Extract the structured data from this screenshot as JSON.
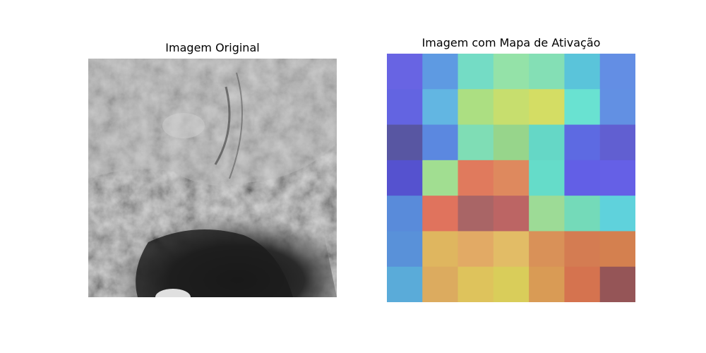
{
  "panels": {
    "left": {
      "title": "Imagem Original"
    },
    "right": {
      "title": "Imagem com Mapa de Ativação"
    }
  },
  "heatmap": {
    "rows": 7,
    "cols": 7,
    "colors": [
      [
        "#6864e3",
        "#5e9ae2",
        "#74dcc5",
        "#94e2a8",
        "#84dfb5",
        "#5ac4da",
        "#638ee4"
      ],
      [
        "#6364e1",
        "#62b6e2",
        "#acdf82",
        "#c7de6e",
        "#d4dd64",
        "#69e2d1",
        "#6290e3"
      ],
      [
        "#5856a2",
        "#5b88e0",
        "#7fddb5",
        "#97d58b",
        "#65d7c6",
        "#5d6ae2",
        "#615fd1"
      ],
      [
        "#5552cf",
        "#a1de91",
        "#e07a5d",
        "#de895e",
        "#65dcc9",
        "#625fe6",
        "#6560e6"
      ],
      [
        "#598bda",
        "#e0735d",
        "#a96566",
        "#bc6564",
        "#9ddb96",
        "#74dab9",
        "#5fd2dc"
      ],
      [
        "#5991d9",
        "#dfb65f",
        "#e2aa65",
        "#e2bc66",
        "#d99158",
        "#d47c52",
        "#d4804f"
      ],
      [
        "#5aabd9",
        "#dcab5f",
        "#dec35c",
        "#d9cd5a",
        "#d99b55",
        "#d5734f",
        "#955557"
      ]
    ]
  }
}
